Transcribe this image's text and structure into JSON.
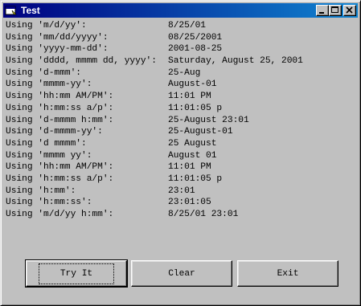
{
  "window": {
    "title": "Test",
    "icon": "app-window-icon",
    "controls": [
      "minimize-icon",
      "maximize-icon",
      "close-icon"
    ]
  },
  "rows": [
    {
      "label": "Using 'm/d/yy':",
      "value": "8/25/01"
    },
    {
      "label": "Using 'mm/dd/yyyy':",
      "value": "08/25/2001"
    },
    {
      "label": "Using 'yyyy-mm-dd':",
      "value": "2001-08-25"
    },
    {
      "label": "Using 'dddd, mmmm dd, yyyy':",
      "value": "Saturday, August 25, 2001"
    },
    {
      "label": "Using 'd-mmm':",
      "value": "25-Aug"
    },
    {
      "label": "Using 'mmmm-yy':",
      "value": "August-01"
    },
    {
      "label": "Using 'hh:mm AM/PM':",
      "value": "11:01 PM"
    },
    {
      "label": "Using 'h:mm:ss a/p':",
      "value": "11:01:05 p"
    },
    {
      "label": "Using 'd-mmmm h:mm':",
      "value": "25-August 23:01"
    },
    {
      "label": "Using 'd-mmmm-yy':",
      "value": "25-August-01"
    },
    {
      "label": "Using 'd mmmm':",
      "value": "25 August"
    },
    {
      "label": "Using 'mmmm yy':",
      "value": "August 01"
    },
    {
      "label": "Using 'hh:mm AM/PM':",
      "value": "11:01 PM"
    },
    {
      "label": "Using 'h:mm:ss a/p':",
      "value": "11:01:05 p"
    },
    {
      "label": "Using 'h:mm':",
      "value": "23:01"
    },
    {
      "label": "Using 'h:mm:ss':",
      "value": "23:01:05"
    },
    {
      "label": "Using 'm/d/yy h:mm':",
      "value": "8/25/01 23:01"
    }
  ],
  "buttons": {
    "try_it": "Try It",
    "clear": "Clear",
    "exit": "Exit"
  },
  "colors": {
    "title_bar": "#000080",
    "face": "#c0c0c0"
  }
}
